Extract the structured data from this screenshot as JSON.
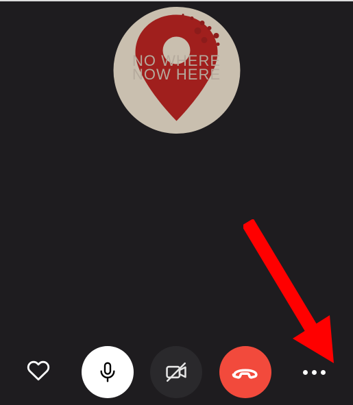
{
  "avatar": {
    "line1": "NO WHERE",
    "line2": "NOW HERE",
    "bg": "#c9bfaf",
    "pin_color": "#a01f1d"
  },
  "controls": {
    "react": {
      "name": "heart-icon",
      "interactable": true
    },
    "mic": {
      "name": "microphone-button",
      "interactable": true
    },
    "video": {
      "name": "video-off-button",
      "interactable": true
    },
    "end": {
      "name": "end-call-button",
      "interactable": true
    },
    "more": {
      "name": "more-options-button",
      "interactable": true
    }
  },
  "annotation": {
    "arrow_color": "#ff0000",
    "target": "more-options-button"
  }
}
